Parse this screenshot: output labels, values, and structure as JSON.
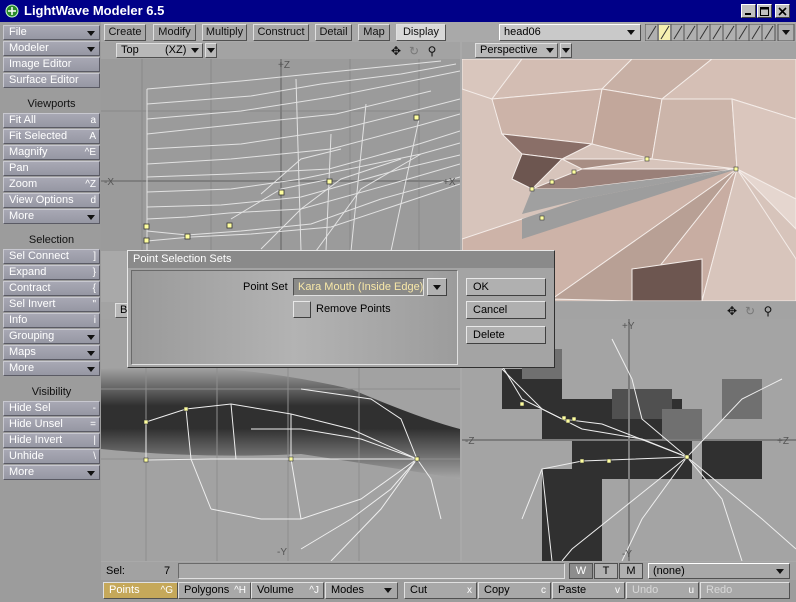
{
  "window": {
    "title": "LightWave Modeler 6.5"
  },
  "left_panel": {
    "top_buttons": [
      {
        "label": "File"
      },
      {
        "label": "Modeler"
      },
      {
        "label": "Image Editor"
      },
      {
        "label": "Surface Editor"
      }
    ],
    "viewports_header": "Viewports",
    "viewport_buttons": [
      {
        "label": "Fit All",
        "shortcut": "a"
      },
      {
        "label": "Fit Selected",
        "shortcut": "A"
      },
      {
        "label": "Magnify",
        "shortcut": "^E"
      },
      {
        "label": "Pan",
        "shortcut": ""
      },
      {
        "label": "Zoom",
        "shortcut": "^Z"
      },
      {
        "label": "View Options",
        "shortcut": "d"
      },
      {
        "label": "More",
        "shortcut": ""
      }
    ],
    "selection_header": "Selection",
    "selection_buttons": [
      {
        "label": "Sel Connect",
        "shortcut": "]"
      },
      {
        "label": "Expand",
        "shortcut": "}"
      },
      {
        "label": "Contract",
        "shortcut": "{"
      },
      {
        "label": "Sel Invert",
        "shortcut": "\""
      },
      {
        "label": "Info",
        "shortcut": "i"
      },
      {
        "label": "Grouping",
        "shortcut": ""
      },
      {
        "label": "Maps",
        "shortcut": ""
      },
      {
        "label": "More",
        "shortcut": ""
      }
    ],
    "visibility_header": "Visibility",
    "visibility_buttons": [
      {
        "label": "Hide Sel",
        "shortcut": "-"
      },
      {
        "label": "Hide Unsel",
        "shortcut": "="
      },
      {
        "label": "Hide Invert",
        "shortcut": "|"
      },
      {
        "label": "Unhide",
        "shortcut": "\\"
      },
      {
        "label": "More",
        "shortcut": ""
      }
    ]
  },
  "tabs": [
    "Create",
    "Modify",
    "Multiply",
    "Construct",
    "Detail",
    "Map",
    "Display"
  ],
  "active_tab": "Display",
  "object_select": {
    "value": "head06"
  },
  "viewports": {
    "top": {
      "label": "Top",
      "axes": "(XZ)",
      "axis_labels": [
        "+Z",
        "-X",
        "+X"
      ]
    },
    "perspective": {
      "label": "Perspective"
    },
    "back": {
      "label": "B",
      "axis_labels": [
        "-Y"
      ]
    },
    "right": {
      "axis_labels": [
        "+Y",
        "-Z",
        "+Z",
        "-Y"
      ]
    }
  },
  "dialog": {
    "title": "Point Selection Sets",
    "point_set_label": "Point Set",
    "point_set_value": "Kara Mouth (Inside Edge)",
    "remove_points_label": "Remove Points",
    "ok": "OK",
    "cancel": "Cancel",
    "delete": "Delete"
  },
  "status": {
    "sel_label": "Sel:",
    "sel_count": "7"
  },
  "wtm": [
    "W",
    "T",
    "M"
  ],
  "surface_select": "(none)",
  "bottom_bar": [
    {
      "label": "Points",
      "shortcut": "^G"
    },
    {
      "label": "Polygons",
      "shortcut": "^H"
    },
    {
      "label": "Volume",
      "shortcut": "^J"
    },
    {
      "label": "Modes",
      "shortcut": ""
    },
    {
      "label": "Cut",
      "shortcut": "x"
    },
    {
      "label": "Copy",
      "shortcut": "c"
    },
    {
      "label": "Paste",
      "shortcut": "v"
    },
    {
      "label": "Undo",
      "shortcut": "u"
    },
    {
      "label": "Redo",
      "shortcut": ""
    }
  ],
  "colors": {
    "titlebar": "#000088",
    "active_mode": "#f8e08a",
    "points_fill": "#ffffa0"
  }
}
